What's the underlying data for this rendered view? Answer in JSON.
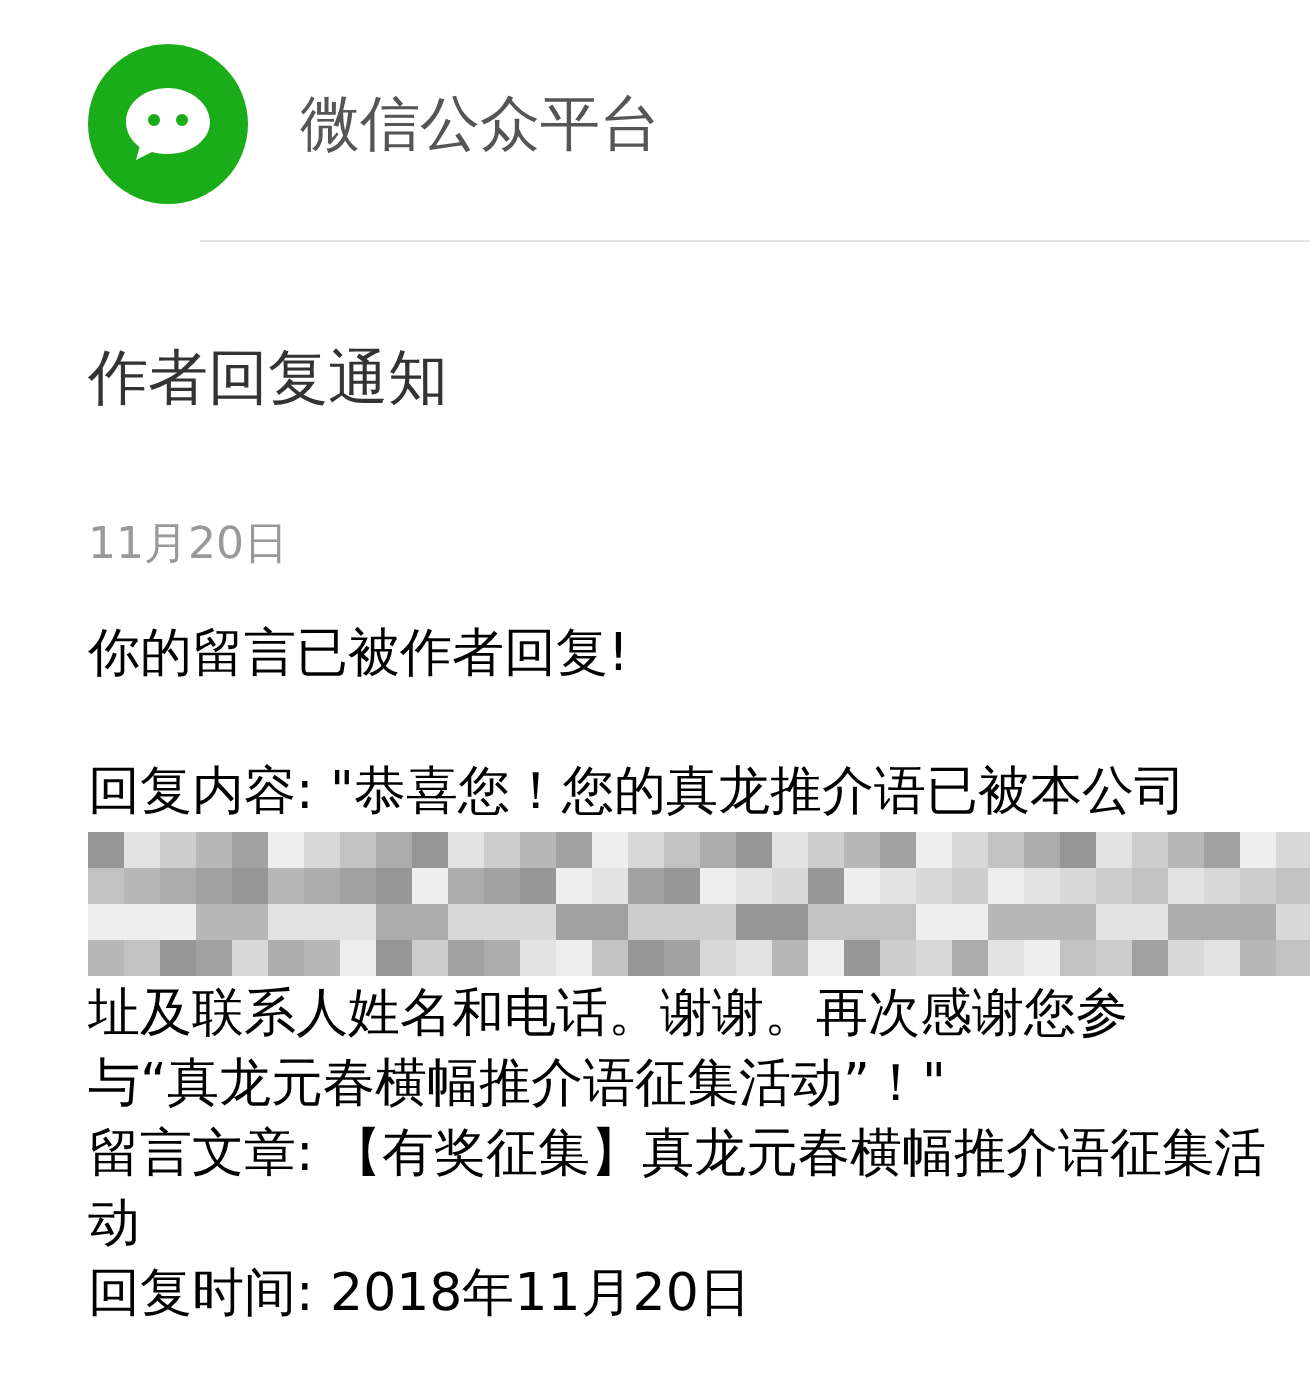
{
  "header": {
    "title": "微信公众平台"
  },
  "notice": {
    "title": "作者回复通知",
    "date": "11月20日",
    "message": "你的留言已被作者回复!",
    "reply_lines_before": [
      "回复内容: \"恭喜您！您的真龙推介语已被本公司"
    ],
    "reply_lines_after": [
      "址及联系人姓名和电话。谢谢。再次感谢您参",
      "与“真龙元春横幅推介语征集活动”！\""
    ],
    "article": "留言文章: 【有奖征集】真龙元春横幅推介语征集活动",
    "reply_time": "回复时间: 2018年11月20日"
  }
}
